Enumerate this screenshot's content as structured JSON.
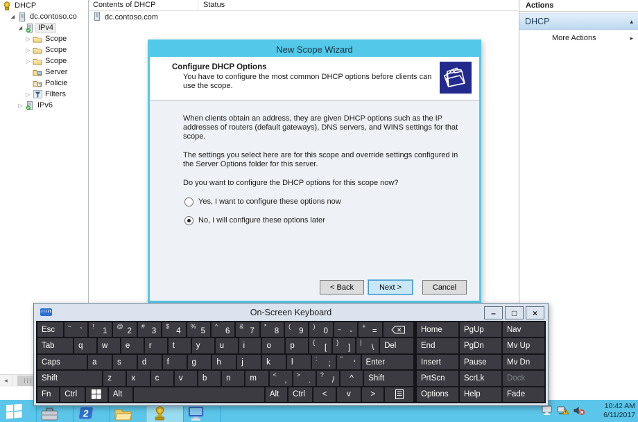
{
  "console": {
    "tree": [
      {
        "label": "DHCP",
        "n": "dhcp-root",
        "level": 0,
        "icon": "dhcp-root",
        "arrow": ""
      },
      {
        "label": "dc.contoso.co",
        "n": "dc-contoso-com",
        "level": 1,
        "icon": "server",
        "arrow": "expanded"
      },
      {
        "label": "IPv4",
        "n": "ipv4",
        "level": 2,
        "icon": "server-check",
        "arrow": "expanded",
        "highlighted": true
      },
      {
        "label": "Scope",
        "n": "scope-1",
        "level": 3,
        "icon": "folder",
        "arrow": "collapsed"
      },
      {
        "label": "Scope",
        "n": "scope-2",
        "level": 3,
        "icon": "folder",
        "arrow": "collapsed"
      },
      {
        "label": "Scope",
        "n": "scope-3",
        "level": 3,
        "icon": "folder",
        "arrow": "collapsed"
      },
      {
        "label": "Server",
        "n": "server-options",
        "level": 3,
        "icon": "folder-gear",
        "arrow": ""
      },
      {
        "label": "Policie",
        "n": "policies",
        "level": 3,
        "icon": "folder-policy",
        "arrow": ""
      },
      {
        "label": "Filters",
        "n": "filters",
        "level": 3,
        "icon": "filter",
        "arrow": "collapsed"
      },
      {
        "label": "IPv6",
        "n": "ipv6",
        "level": 2,
        "icon": "server-check",
        "arrow": "collapsed"
      }
    ],
    "columns": [
      "Contents of DHCP",
      "Status"
    ],
    "rows": [
      {
        "name": "dc.contoso.com"
      }
    ],
    "actions": {
      "title": "Actions",
      "section": "DHCP",
      "collapse_glyph": "▴",
      "more": "More Actions",
      "more_glyph": "▸"
    }
  },
  "wizard": {
    "title": "New Scope Wizard",
    "heading": "Configure DHCP Options",
    "subheading": "You have to configure the most common DHCP options before clients can use the scope.",
    "p1": "When clients obtain an address, they are given DHCP options such as the IP addresses of routers (default gateways), DNS servers, and WINS settings for that scope.",
    "p2": "The settings you select here are for this scope and override settings configured in the Server Options folder for this server.",
    "p3": "Do you want to configure the DHCP options for this scope now?",
    "radio_yes": "Yes, I want to configure these options now",
    "radio_no": "No, I will configure these options later",
    "selected": "no",
    "buttons": {
      "back": "< Back",
      "next": "Next >",
      "cancel": "Cancel"
    }
  },
  "osk": {
    "title": "On-Screen Keyboard",
    "window_buttons": [
      {
        "n": "minimize",
        "g": "–"
      },
      {
        "n": "maximize",
        "g": "□"
      },
      {
        "n": "close",
        "g": "×"
      }
    ],
    "main_rows": [
      [
        {
          "t": "Esc",
          "n": "esc",
          "f": 1.1
        },
        {
          "s": "~",
          "m": "`",
          "n": "backquote"
        },
        {
          "s": "!",
          "m": "1",
          "n": "1"
        },
        {
          "s": "@",
          "m": "2",
          "n": "2"
        },
        {
          "s": "#",
          "m": "3",
          "n": "3"
        },
        {
          "s": "$",
          "m": "4",
          "n": "4"
        },
        {
          "s": "%",
          "m": "5",
          "n": "5"
        },
        {
          "s": "^",
          "m": "6",
          "n": "6"
        },
        {
          "s": "&",
          "m": "7",
          "n": "7"
        },
        {
          "s": "*",
          "m": "8",
          "n": "8"
        },
        {
          "s": "(",
          "m": "9",
          "n": "9"
        },
        {
          "s": ")",
          "m": "0",
          "n": "0"
        },
        {
          "s": "_",
          "m": "-",
          "n": "minus"
        },
        {
          "s": "+",
          "m": "=",
          "n": "equals"
        },
        {
          "icon": "backspace",
          "n": "backspace",
          "f": 1.3
        }
      ],
      [
        {
          "t": "Tab",
          "n": "tab",
          "f": 1.6
        },
        {
          "t": "q",
          "n": "q"
        },
        {
          "t": "w",
          "n": "w"
        },
        {
          "t": "e",
          "n": "e"
        },
        {
          "t": "r",
          "n": "r"
        },
        {
          "t": "t",
          "n": "t"
        },
        {
          "t": "y",
          "n": "y"
        },
        {
          "t": "u",
          "n": "u"
        },
        {
          "t": "i",
          "n": "i"
        },
        {
          "t": "o",
          "n": "o"
        },
        {
          "t": "p",
          "n": "p"
        },
        {
          "s": "{",
          "m": "[",
          "n": "bracket-left"
        },
        {
          "s": "}",
          "m": "]",
          "n": "bracket-right"
        },
        {
          "s": "|",
          "m": "\\",
          "n": "backslash"
        },
        {
          "t": "Del",
          "n": "del",
          "f": 1.5
        }
      ],
      [
        {
          "t": "Caps",
          "n": "caps",
          "f": 2.1
        },
        {
          "t": "a",
          "n": "a"
        },
        {
          "t": "s",
          "n": "s"
        },
        {
          "t": "d",
          "n": "d"
        },
        {
          "t": "f",
          "n": "f"
        },
        {
          "t": "g",
          "n": "g"
        },
        {
          "t": "h",
          "n": "h"
        },
        {
          "t": "j",
          "n": "j"
        },
        {
          "t": "k",
          "n": "k"
        },
        {
          "t": "l",
          "n": "l"
        },
        {
          "s": ":",
          "m": ";",
          "n": "semicolon"
        },
        {
          "s": "\"",
          "m": "'",
          "n": "apostrophe"
        },
        {
          "t": "Enter",
          "n": "enter",
          "f": 2.2
        }
      ],
      [
        {
          "t": "Shift",
          "n": "shift-left",
          "f": 2.9
        },
        {
          "t": "z",
          "n": "z"
        },
        {
          "t": "x",
          "n": "x"
        },
        {
          "t": "c",
          "n": "c"
        },
        {
          "t": "v",
          "n": "v"
        },
        {
          "t": "b",
          "n": "b"
        },
        {
          "t": "n",
          "n": "n"
        },
        {
          "t": "m",
          "n": "m"
        },
        {
          "s": "<",
          "m": ",",
          "n": "comma"
        },
        {
          "s": ">",
          "m": ".",
          "n": "period"
        },
        {
          "s": "?",
          "m": "/",
          "n": "slash"
        },
        {
          "t": "^",
          "n": "up-arrow",
          "c": 1
        },
        {
          "t": "Shift",
          "n": "shift-right",
          "f": 2.2
        }
      ],
      [
        {
          "t": "Fn",
          "n": "fn"
        },
        {
          "t": "Ctrl",
          "n": "ctrl-left",
          "f": 1.1
        },
        {
          "icon": "win",
          "n": "windows"
        },
        {
          "t": "Alt",
          "n": "alt-left",
          "f": 1.1
        },
        {
          "t": "",
          "n": "space",
          "f": 6.0
        },
        {
          "t": "Alt",
          "n": "alt-right"
        },
        {
          "t": "Ctrl",
          "n": "ctrl-right",
          "f": 1.1
        },
        {
          "t": "<",
          "n": "left-arrow",
          "c": 1
        },
        {
          "t": "v",
          "n": "down-arrow",
          "c": 1,
          "f": 1.1
        },
        {
          "t": ">",
          "n": "right-arrow",
          "c": 1
        },
        {
          "icon": "menu",
          "n": "menu",
          "f": 1.3
        }
      ]
    ],
    "side_rows": [
      [
        {
          "t": "Home",
          "n": "home"
        },
        {
          "t": "PgUp",
          "n": "pgup"
        },
        {
          "t": "Nav",
          "n": "nav"
        }
      ],
      [
        {
          "t": "End",
          "n": "end"
        },
        {
          "t": "PgDn",
          "n": "pgdn"
        },
        {
          "t": "Mv Up",
          "n": "mv-up"
        }
      ],
      [
        {
          "t": "Insert",
          "n": "insert"
        },
        {
          "t": "Pause",
          "n": "pause"
        },
        {
          "t": "Mv Dn",
          "n": "mv-dn"
        }
      ],
      [
        {
          "t": "PrtScn",
          "n": "prtscn"
        },
        {
          "t": "ScrLk",
          "n": "scrlk"
        },
        {
          "t": "Dock",
          "n": "dock",
          "disabled": true
        }
      ],
      [
        {
          "t": "Options",
          "n": "options"
        },
        {
          "t": "Help",
          "n": "help"
        },
        {
          "t": "Fade",
          "n": "fade"
        }
      ]
    ]
  },
  "taskbar": {
    "apps": [
      {
        "n": "server-manager"
      },
      {
        "n": "app-2"
      },
      {
        "n": "file-explorer"
      },
      {
        "n": "dhcp-console",
        "active": true
      },
      {
        "n": "computer"
      }
    ],
    "tray": [
      {
        "n": "display"
      },
      {
        "n": "network-warning"
      },
      {
        "n": "volume-muted"
      }
    ],
    "time": "10:42 AM",
    "date": "6/11/2017"
  }
}
